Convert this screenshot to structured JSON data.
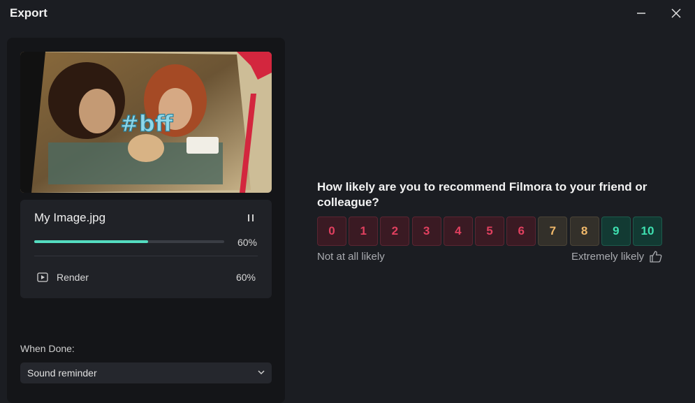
{
  "window": {
    "title": "Export"
  },
  "preview": {
    "overlay_text": "#bff"
  },
  "progress": {
    "file_name": "My Image.jpg",
    "percent_label": "60%",
    "fraction": 0.6,
    "step_label": "Render",
    "step_percent": "60%"
  },
  "when_done": {
    "label": "When Done:",
    "selected": "Sound reminder"
  },
  "survey": {
    "question": "How likely are you to recommend Filmora to your friend or colleague?",
    "low_label": "Not at all likely",
    "high_label": "Extremely likely",
    "scores": [
      "0",
      "1",
      "2",
      "3",
      "4",
      "5",
      "6",
      "7",
      "8",
      "9",
      "10"
    ],
    "colors": {
      "detractor_text": "#e0405f",
      "detractor_bg": "#3a1a23",
      "detractor_border": "#5a2532",
      "passive_text": "#f0b86a",
      "passive_bg": "#33302a",
      "passive_border": "#4a4336",
      "promoter_text": "#3ee0b0",
      "promoter_bg": "#123a33",
      "promoter_border": "#1d5a4c"
    }
  }
}
